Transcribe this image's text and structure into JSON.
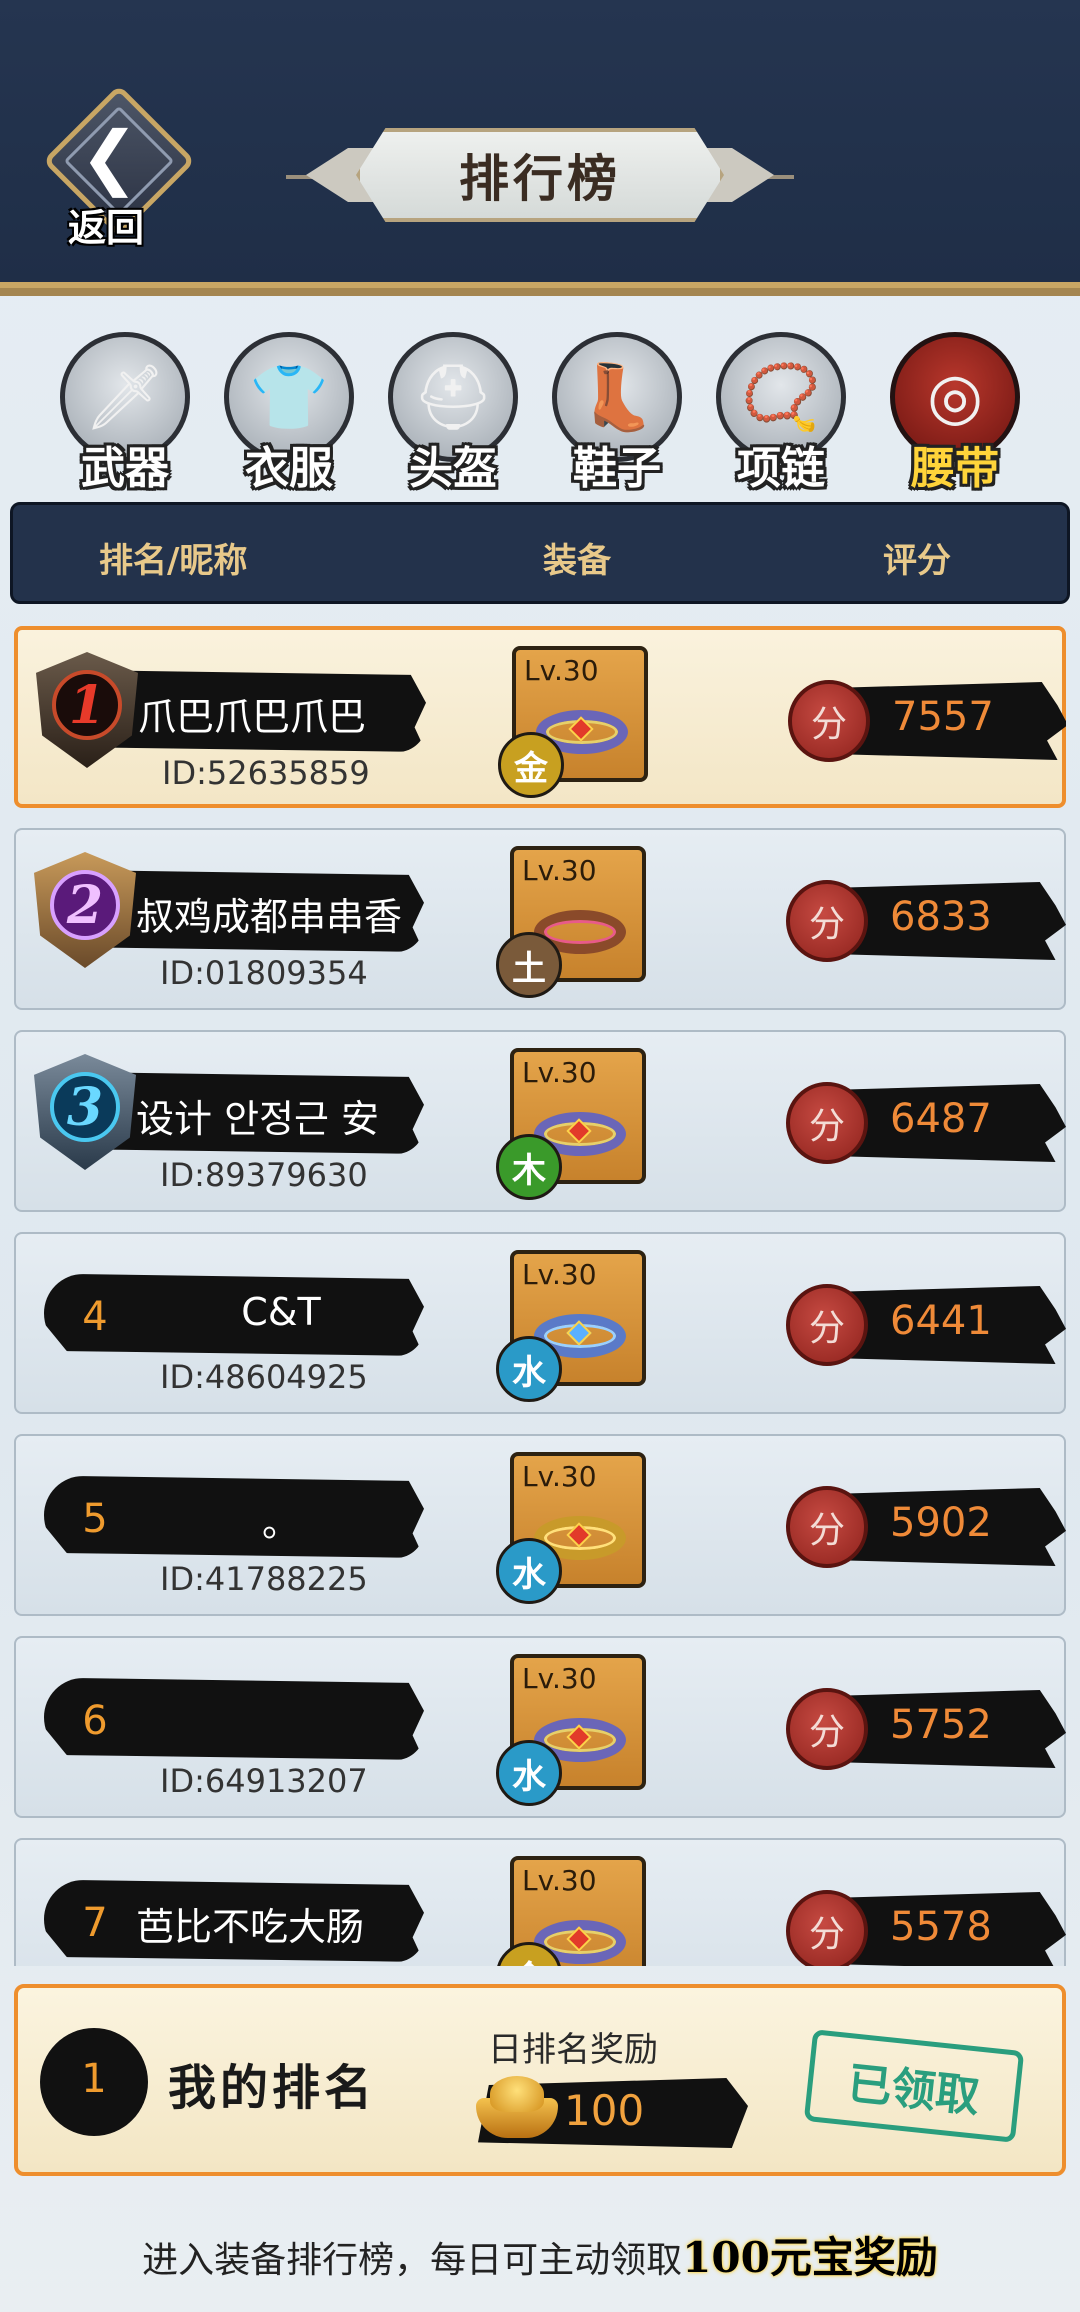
{
  "header": {
    "back_label": "返回",
    "title": "排行榜"
  },
  "tabs": [
    {
      "label": "武器",
      "icon": "sword-icon",
      "active": false
    },
    {
      "label": "衣服",
      "icon": "armor-icon",
      "active": false
    },
    {
      "label": "头盔",
      "icon": "helmet-icon",
      "active": false
    },
    {
      "label": "鞋子",
      "icon": "boot-icon",
      "active": false
    },
    {
      "label": "项链",
      "icon": "necklace-icon",
      "active": false
    },
    {
      "label": "腰带",
      "icon": "belt-icon",
      "active": true
    }
  ],
  "table_header": {
    "rank_name": "排名/昵称",
    "equip": "装备",
    "score": "评分"
  },
  "rows": [
    {
      "rank": "1",
      "name": "爪巴爪巴爪巴",
      "id": "ID:52635859",
      "level": "Lv.30",
      "element": "金",
      "element_color": "#c8a020",
      "score_icon": "分",
      "score": "7557"
    },
    {
      "rank": "2",
      "name": "叔鸡成都串串香",
      "id": "ID:01809354",
      "level": "Lv.30",
      "element": "土",
      "element_color": "#7a5a3a",
      "score_icon": "分",
      "score": "6833"
    },
    {
      "rank": "3",
      "name": "设计 안정근 安",
      "id": "ID:89379630",
      "level": "Lv.30",
      "element": "木",
      "element_color": "#3a9a2a",
      "score_icon": "分",
      "score": "6487"
    },
    {
      "rank": "4",
      "name": "C&T",
      "id": "ID:48604925",
      "level": "Lv.30",
      "element": "水",
      "element_color": "#2a9ac8",
      "score_icon": "分",
      "score": "6441"
    },
    {
      "rank": "5",
      "name": "。",
      "id": "ID:41788225",
      "level": "Lv.30",
      "element": "水",
      "element_color": "#2a9ac8",
      "score_icon": "分",
      "score": "5902"
    },
    {
      "rank": "6",
      "name": "",
      "id": "ID:64913207",
      "level": "Lv.30",
      "element": "水",
      "element_color": "#2a9ac8",
      "score_icon": "分",
      "score": "5752"
    },
    {
      "rank": "7",
      "name": "芭比不吃大肠",
      "id": "",
      "level": "Lv.30",
      "element": "金",
      "element_color": "#c8a020",
      "score_icon": "分",
      "score": "5578"
    }
  ],
  "my_rank": {
    "rank": "1",
    "label": "我的排名",
    "reward_title": "日排名奖励",
    "reward_value": "100",
    "status": "已领取"
  },
  "footer": {
    "text": "进入装备排行榜，每日可主动领取",
    "highlight": "100元宝奖励"
  },
  "colors": {
    "header_bg": "#23324b",
    "accent_orange": "#ee8e2d",
    "score_text": "#ef8a38",
    "claimed_green": "#2a9e7e",
    "active_tab": "#ffd43a"
  }
}
